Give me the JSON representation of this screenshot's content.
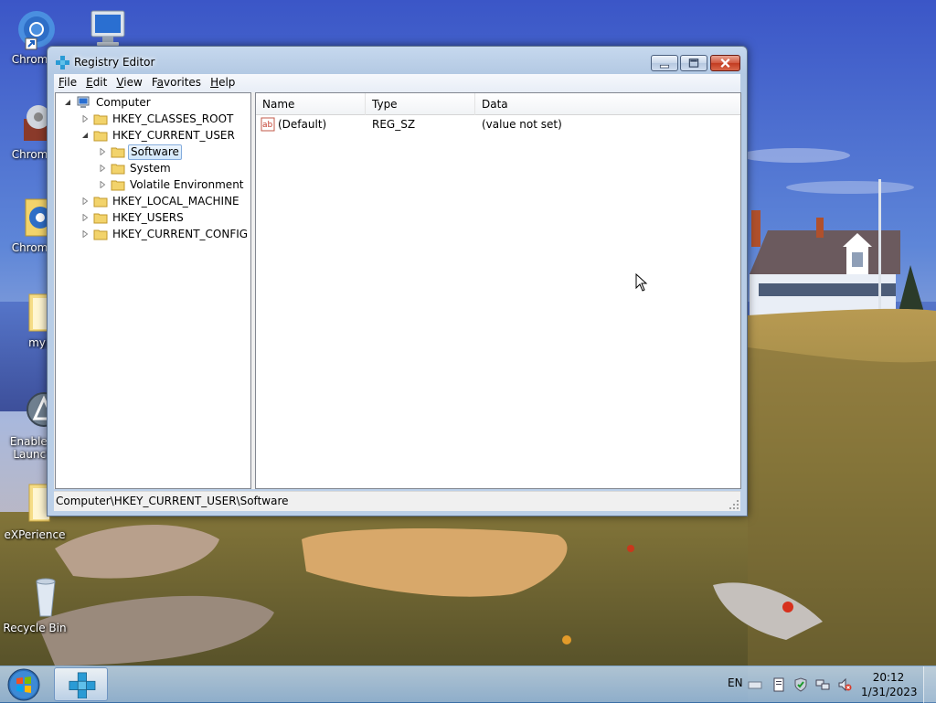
{
  "desktop": {
    "icons": [
      {
        "label": "Chromiu",
        "icon": "chromium-icon"
      },
      {
        "label": "",
        "icon": "computer-icon"
      },
      {
        "label": "Chromiu",
        "icon": "chromium-icon"
      },
      {
        "label": "Chromiu",
        "icon": "chromium-shortcut-icon"
      },
      {
        "label": "mypa",
        "icon": "folder-icon"
      },
      {
        "label": "Enable Q",
        "label2": "Launch.",
        "icon": "enable-quick-launch-icon"
      },
      {
        "label": "eXPerience",
        "icon": "folder-icon"
      },
      {
        "label": "Recycle Bin",
        "icon": "recycle-bin-icon"
      }
    ]
  },
  "window": {
    "title": "Registry Editor",
    "menu": [
      {
        "accel": "F",
        "rest": "ile"
      },
      {
        "accel": "E",
        "rest": "dit"
      },
      {
        "accel": "V",
        "rest": "iew"
      },
      {
        "accel": "Fa",
        "rest": "vorites",
        "accel_index": 1
      },
      {
        "accel": "H",
        "rest": "elp"
      }
    ],
    "tree": {
      "root": "Computer",
      "hkcr": "HKEY_CLASSES_ROOT",
      "hkcu": "HKEY_CURRENT_USER",
      "software": "Software",
      "system": "System",
      "volatile": "Volatile Environment",
      "hklm": "HKEY_LOCAL_MACHINE",
      "hku": "HKEY_USERS",
      "hkcc": "HKEY_CURRENT_CONFIG"
    },
    "list": {
      "columns": [
        "Name",
        "Type",
        "Data"
      ],
      "rows": [
        {
          "name": "(Default)",
          "type": "REG_SZ",
          "data": "(value not set)"
        }
      ]
    },
    "status_path": "Computer\\HKEY_CURRENT_USER\\Software"
  },
  "taskbar": {
    "language": "EN",
    "time": "20:12",
    "date": "1/31/2023"
  },
  "colors": {
    "selection_border": "#84acdd",
    "close_button": "#c23b20",
    "folder": "#f2d36b"
  }
}
